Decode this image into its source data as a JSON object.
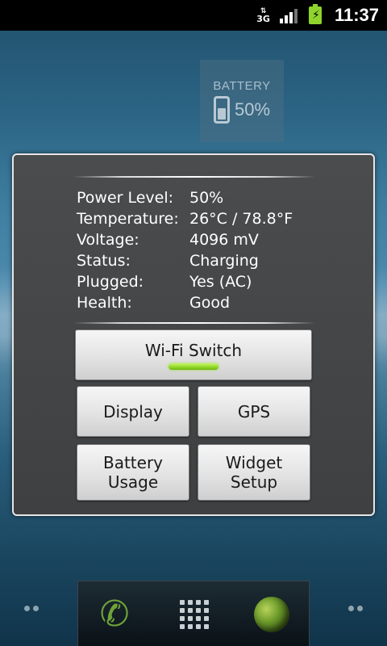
{
  "status_bar": {
    "network": "3G",
    "time": "11:37"
  },
  "battery_widget": {
    "title": "BATTERY",
    "percent": "50%"
  },
  "battery_info": {
    "rows": [
      {
        "label": "Power Level:",
        "value": "50%"
      },
      {
        "label": "Temperature:",
        "value": "26°C / 78.8°F"
      },
      {
        "label": "Voltage:",
        "value": "4096 mV"
      },
      {
        "label": "Status:",
        "value": "Charging"
      },
      {
        "label": "Plugged:",
        "value": "Yes (AC)"
      },
      {
        "label": "Health:",
        "value": "Good"
      }
    ]
  },
  "buttons": {
    "wifi": {
      "label": "Wi-Fi Switch",
      "on": true
    },
    "display": "Display",
    "gps": "GPS",
    "battery_usage_line1": "Battery",
    "battery_usage_line2": "Usage",
    "widget_setup_line1": "Widget",
    "widget_setup_line2": "Setup"
  },
  "colors": {
    "toggle_on": "#8ed625",
    "charging_battery": "#8fd42c"
  },
  "dock": {
    "icons": [
      "phone-icon",
      "app-drawer-icon",
      "browser-icon"
    ]
  }
}
